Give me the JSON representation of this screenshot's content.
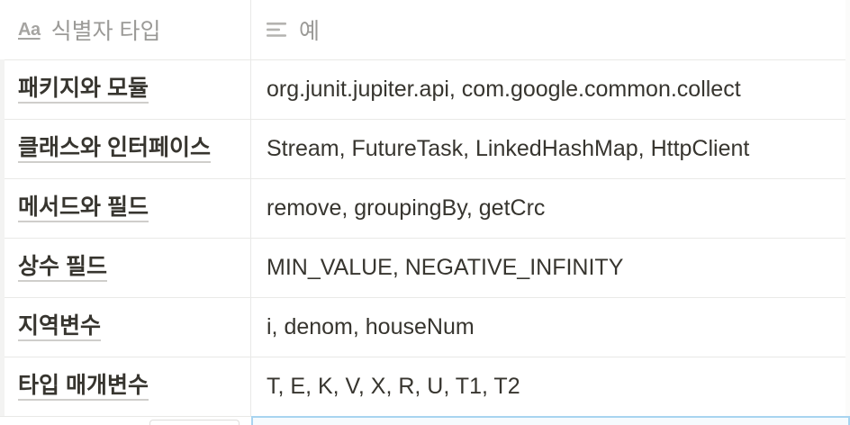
{
  "header": {
    "col1_icon": "text-property-icon",
    "col1_icon_glyph": "Aa",
    "col1_label": "식별자 타입",
    "col2_icon": "text-lines-icon",
    "col2_label": "예"
  },
  "rows": [
    {
      "key": "패키지와 모듈",
      "value": "org.junit.jupiter.api, com.google.common.collect"
    },
    {
      "key": "클래스와 인터페이스",
      "value": "Stream, FutureTask, LinkedHashMap, HttpClient"
    },
    {
      "key": "메서드와 필드",
      "value": "remove, groupingBy, getCrc"
    },
    {
      "key": "상수 필드",
      "value": "MIN_VALUE, NEGATIVE_INFINITY"
    },
    {
      "key": "지역변수",
      "value": "i, denom, houseNum"
    },
    {
      "key": "타입 매개변수",
      "value": "T, E, K, V, X, R, U, T1, T2"
    }
  ],
  "colors": {
    "text": "#37352f",
    "header_text": "#9b9a97",
    "border": "#e9e9e7",
    "selection_border": "#a8d4f0"
  }
}
